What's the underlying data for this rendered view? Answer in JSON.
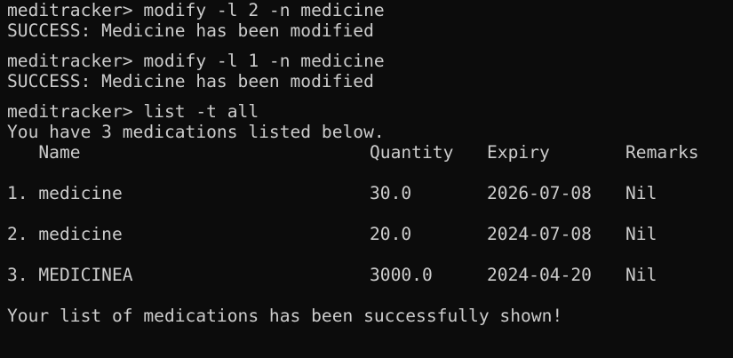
{
  "terminal": {
    "commands": [
      {
        "prompt": "meditracker> ",
        "command": "modify -l 2 -n medicine",
        "output": "SUCCESS: Medicine has been modified"
      },
      {
        "prompt": "meditracker> ",
        "command": "modify -l 1 -n medicine",
        "output": "SUCCESS: Medicine has been modified"
      }
    ],
    "separator": "___________________________________________________________",
    "list_command": {
      "prompt": "meditracker> ",
      "command": "list -t all",
      "summary": "You have 3 medications listed below."
    },
    "table": {
      "headers": {
        "name": "   Name",
        "quantity": "Quantity",
        "expiry": "Expiry",
        "remarks": "Remarks"
      },
      "rows": [
        {
          "name": "1. medicine",
          "quantity": "30.0",
          "expiry": "2026-07-08",
          "remarks": "Nil"
        },
        {
          "name": "2. medicine",
          "quantity": "20.0",
          "expiry": "2024-07-08",
          "remarks": "Nil"
        },
        {
          "name": "3. MEDICINEA",
          "quantity": "3000.0",
          "expiry": "2024-04-20",
          "remarks": "Nil"
        }
      ]
    },
    "footer": "Your list of medications has been successfully shown!"
  }
}
